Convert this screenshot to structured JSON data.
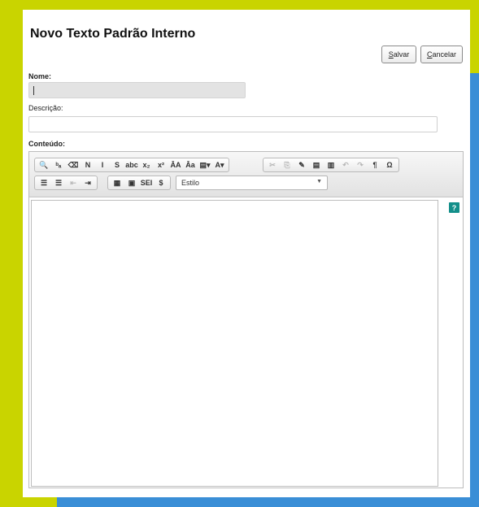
{
  "page": {
    "title": "Novo Texto Padrão Interno"
  },
  "actions": {
    "save": {
      "underlined": "S",
      "rest": "alvar"
    },
    "cancel": {
      "underlined": "C",
      "rest": "ancelar"
    }
  },
  "form": {
    "nome": {
      "label": "Nome:",
      "value": ""
    },
    "descricao": {
      "label": "Descrição:",
      "value": ""
    },
    "conteudo": {
      "label": "Conteúdo:"
    }
  },
  "toolbar": {
    "row1_group1": [
      {
        "name": "find-icon",
        "glyph": "🔍"
      },
      {
        "name": "replace-icon",
        "glyph": "ᵇₐ"
      },
      {
        "name": "eraser-icon",
        "glyph": "⌫"
      },
      {
        "name": "bold-button",
        "glyph": "N"
      },
      {
        "name": "italic-button",
        "glyph": "I"
      },
      {
        "name": "strike-button",
        "glyph": "S"
      },
      {
        "name": "strikethrough-abc-button",
        "glyph": "abc"
      },
      {
        "name": "subscript-button",
        "glyph": "x₂"
      },
      {
        "name": "superscript-button",
        "glyph": "x²"
      },
      {
        "name": "uppercase-button",
        "glyph": "ĀA"
      },
      {
        "name": "lowercase-button",
        "glyph": "Āa"
      },
      {
        "name": "text-color-button",
        "glyph": "▤▾"
      },
      {
        "name": "background-color-button",
        "glyph": "A▾"
      }
    ],
    "row1_group2": [
      {
        "name": "cut-icon",
        "glyph": "✂",
        "disabled": true
      },
      {
        "name": "copy-icon",
        "glyph": "⎘",
        "disabled": true
      },
      {
        "name": "format-painter-icon",
        "glyph": "✎"
      },
      {
        "name": "paste-text-icon",
        "glyph": "▤"
      },
      {
        "name": "paste-word-icon",
        "glyph": "▥"
      },
      {
        "name": "undo-icon",
        "glyph": "↶",
        "disabled": true
      },
      {
        "name": "redo-icon",
        "glyph": "↷",
        "disabled": true
      },
      {
        "name": "paragraph-icon",
        "glyph": "¶"
      },
      {
        "name": "omega-icon",
        "glyph": "Ω"
      }
    ],
    "row2_group1": [
      {
        "name": "numbered-list-icon",
        "glyph": "☰"
      },
      {
        "name": "bullet-list-icon",
        "glyph": "☰"
      },
      {
        "name": "outdent-icon",
        "glyph": "⇤",
        "disabled": true
      },
      {
        "name": "indent-icon",
        "glyph": "⇥"
      }
    ],
    "row2_group2": [
      {
        "name": "table-icon",
        "glyph": "▦"
      },
      {
        "name": "image-icon",
        "glyph": "▣"
      },
      {
        "name": "sei-link-icon",
        "glyph": "SEI"
      },
      {
        "name": "dollar-icon",
        "glyph": "$"
      }
    ],
    "style_combo": "Estilo"
  },
  "help": {
    "glyph": "?"
  },
  "colors": {
    "frame_yellow": "#c9d400",
    "frame_blue": "#3a8ed6",
    "help_teal": "#138f8a"
  }
}
